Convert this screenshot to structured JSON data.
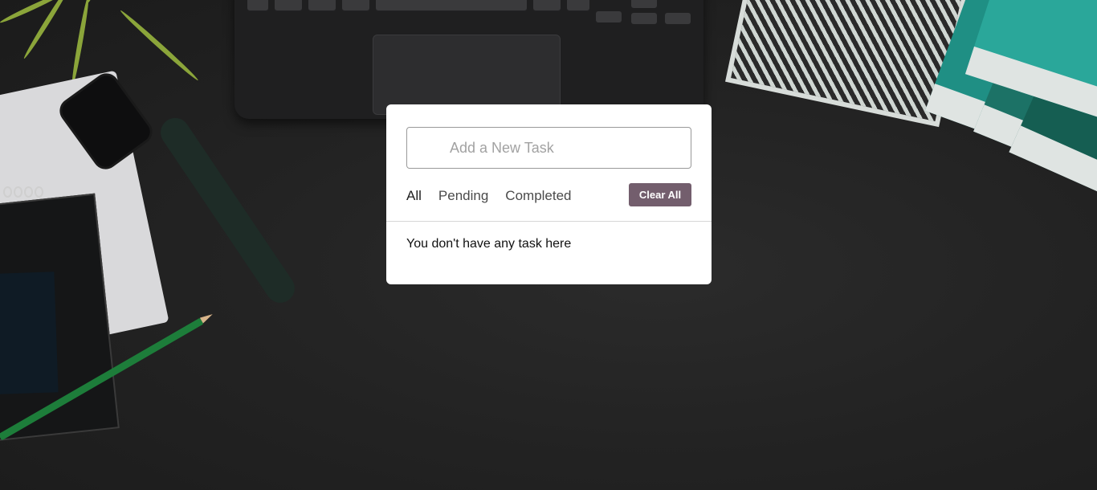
{
  "task_input": {
    "placeholder": "Add a New Task",
    "value": ""
  },
  "filters": {
    "items": [
      {
        "label": "All",
        "active": true
      },
      {
        "label": "Pending",
        "active": false
      },
      {
        "label": "Completed",
        "active": false
      }
    ]
  },
  "clear_button": {
    "label": "Clear All"
  },
  "task_list": {
    "empty_message": "You don't have any task here"
  },
  "colors": {
    "accent": "#735e6d",
    "card_background": "#ffffff",
    "page_background": "#232323"
  }
}
